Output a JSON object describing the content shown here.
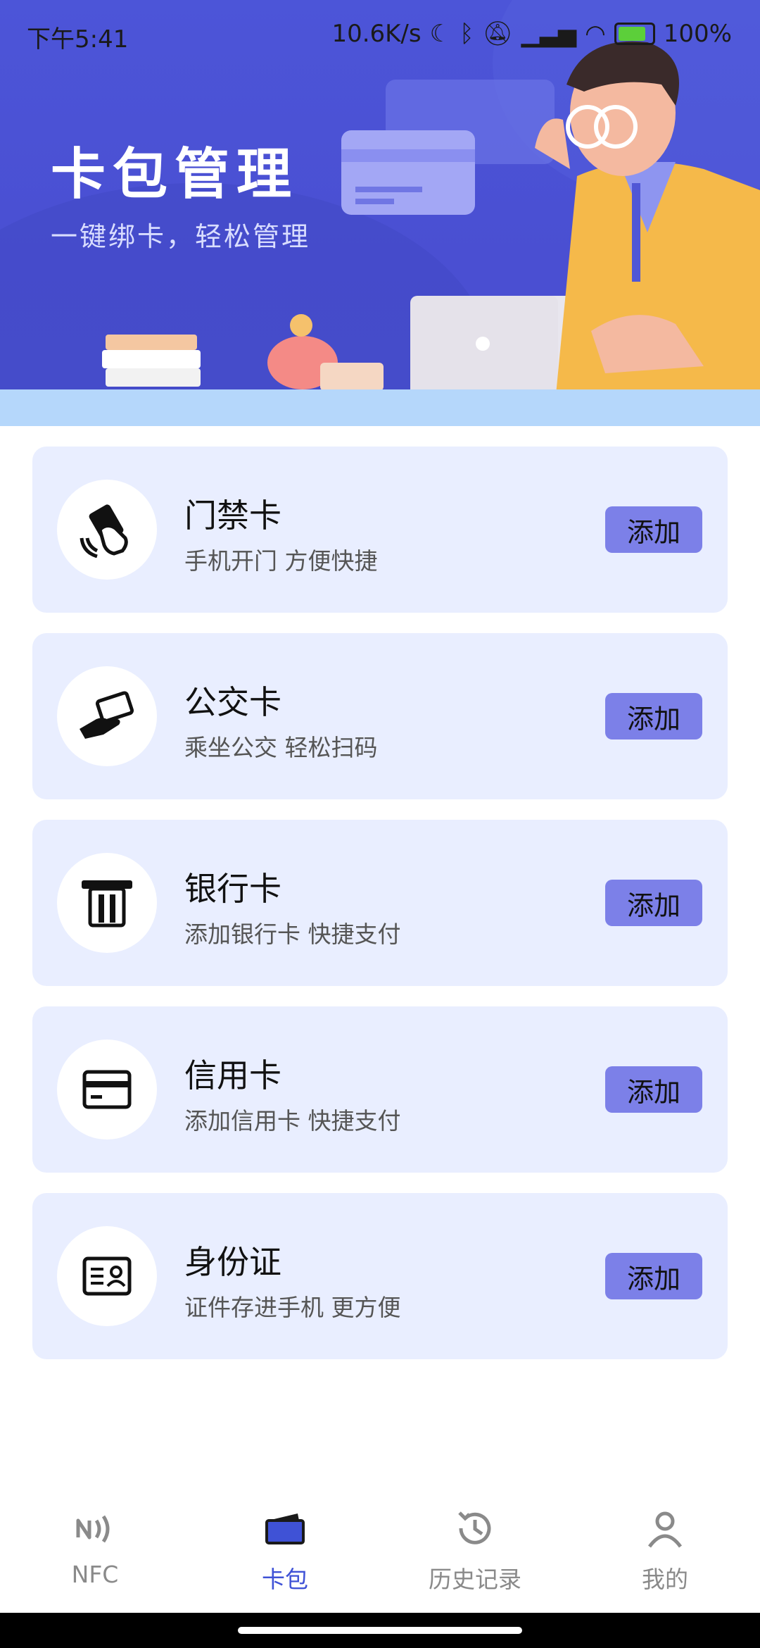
{
  "status_bar": {
    "time": "下午5:41",
    "net_speed": "10.6K/s",
    "battery": "100%"
  },
  "banner": {
    "title": "卡包管理",
    "subtitle": "一键绑卡，轻松管理"
  },
  "cards": [
    {
      "title": "门禁卡",
      "desc": "手机开门 方便快捷",
      "button": "添加",
      "icon": "access-card-icon"
    },
    {
      "title": "公交卡",
      "desc": "乘坐公交 轻松扫码",
      "button": "添加",
      "icon": "bus-card-icon"
    },
    {
      "title": "银行卡",
      "desc": "添加银行卡 快捷支付",
      "button": "添加",
      "icon": "atm-card-icon"
    },
    {
      "title": "信用卡",
      "desc": "添加信用卡 快捷支付",
      "button": "添加",
      "icon": "credit-card-icon"
    },
    {
      "title": "身份证",
      "desc": "证件存进手机 更方便",
      "button": "添加",
      "icon": "id-card-icon"
    }
  ],
  "nav": [
    {
      "label": "NFC",
      "icon": "nfc-icon",
      "active": false
    },
    {
      "label": "卡包",
      "icon": "wallet-icon",
      "active": true
    },
    {
      "label": "历史记录",
      "icon": "history-icon",
      "active": false
    },
    {
      "label": "我的",
      "icon": "profile-icon",
      "active": false
    }
  ],
  "colors": {
    "banner": "#4b50d0",
    "card_bg": "#e9eeff",
    "button": "#7c80e8",
    "active_tab": "#3f52d6"
  }
}
